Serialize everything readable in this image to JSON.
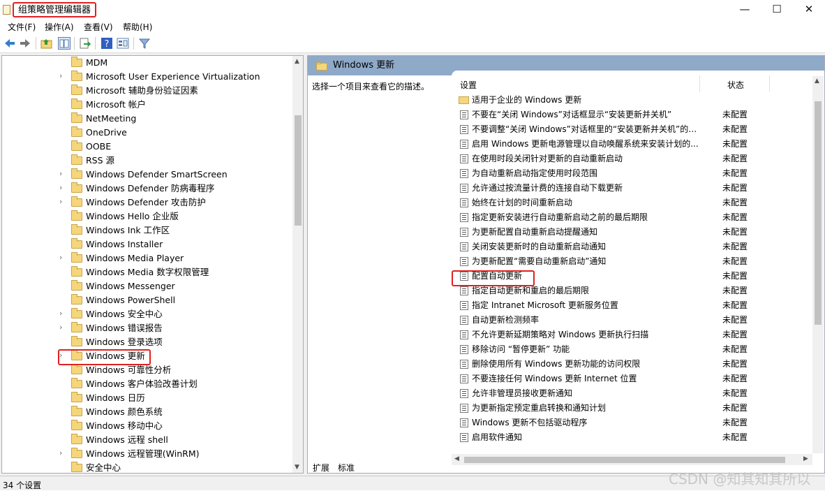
{
  "window": {
    "title": "组策略管理编辑器",
    "min": "—",
    "max": "☐",
    "close": "✕"
  },
  "menu": [
    "文件(F)",
    "操作(A)",
    "查看(V)",
    "帮助(H)"
  ],
  "tree": [
    {
      "label": "MDM",
      "chevron": false
    },
    {
      "label": "Microsoft User Experience Virtualization",
      "chevron": true
    },
    {
      "label": "Microsoft 辅助身份验证因素",
      "chevron": false
    },
    {
      "label": "Microsoft 帐户",
      "chevron": false
    },
    {
      "label": "NetMeeting",
      "chevron": false
    },
    {
      "label": "OneDrive",
      "chevron": false
    },
    {
      "label": "OOBE",
      "chevron": false
    },
    {
      "label": "RSS 源",
      "chevron": false
    },
    {
      "label": "Windows Defender SmartScreen",
      "chevron": true
    },
    {
      "label": "Windows Defender 防病毒程序",
      "chevron": true
    },
    {
      "label": "Windows Defender 攻击防护",
      "chevron": true
    },
    {
      "label": "Windows Hello 企业版",
      "chevron": false
    },
    {
      "label": "Windows Ink 工作区",
      "chevron": false
    },
    {
      "label": "Windows Installer",
      "chevron": false
    },
    {
      "label": "Windows Media Player",
      "chevron": true
    },
    {
      "label": "Windows Media 数字权限管理",
      "chevron": false
    },
    {
      "label": "Windows Messenger",
      "chevron": false
    },
    {
      "label": "Windows PowerShell",
      "chevron": false
    },
    {
      "label": "Windows 安全中心",
      "chevron": true
    },
    {
      "label": "Windows 错误报告",
      "chevron": true
    },
    {
      "label": "Windows 登录选项",
      "chevron": false
    },
    {
      "label": "Windows 更新",
      "chevron": true
    },
    {
      "label": "Windows 可靠性分析",
      "chevron": false
    },
    {
      "label": "Windows 客户体验改善计划",
      "chevron": false
    },
    {
      "label": "Windows 日历",
      "chevron": false
    },
    {
      "label": "Windows 颜色系统",
      "chevron": false
    },
    {
      "label": "Windows 移动中心",
      "chevron": false
    },
    {
      "label": "Windows 远程 shell",
      "chevron": false
    },
    {
      "label": "Windows 远程管理(WinRM)",
      "chevron": true
    },
    {
      "label": "安全中心",
      "chevron": false
    }
  ],
  "right": {
    "header": "Windows 更新",
    "description": "选择一个项目来查看它的描述。",
    "col_setting": "设置",
    "col_state": "状态",
    "rows": [
      {
        "text": "适用于企业的 Windows 更新",
        "state": "",
        "folder": true
      },
      {
        "text": "不要在“关闭 Windows”对话框显示“安装更新并关机”",
        "state": "未配置",
        "folder": false
      },
      {
        "text": "不要调整“关闭 Windows”对话框里的“安装更新并关机”的默...",
        "state": "未配置",
        "folder": false
      },
      {
        "text": "启用 Windows 更新电源管理以自动唤醒系统来安装计划的...",
        "state": "未配置",
        "folder": false
      },
      {
        "text": "在使用时段关闭针对更新的自动重新启动",
        "state": "未配置",
        "folder": false
      },
      {
        "text": "为自动重新启动指定使用时段范围",
        "state": "未配置",
        "folder": false
      },
      {
        "text": "允许通过按流量计费的连接自动下载更新",
        "state": "未配置",
        "folder": false
      },
      {
        "text": "始终在计划的时间重新启动",
        "state": "未配置",
        "folder": false
      },
      {
        "text": "指定更新安装进行自动重新启动之前的最后期限",
        "state": "未配置",
        "folder": false
      },
      {
        "text": "为更新配置自动重新启动提醒通知",
        "state": "未配置",
        "folder": false
      },
      {
        "text": "关闭安装更新时的自动重新启动通知",
        "state": "未配置",
        "folder": false
      },
      {
        "text": "为更新配置“需要自动重新启动”通知",
        "state": "未配置",
        "folder": false
      },
      {
        "text": "配置自动更新",
        "state": "未配置",
        "folder": false
      },
      {
        "text": "指定自动更新和重启的最后期限",
        "state": "未配置",
        "folder": false
      },
      {
        "text": "指定 Intranet Microsoft 更新服务位置",
        "state": "未配置",
        "folder": false
      },
      {
        "text": "自动更新检测频率",
        "state": "未配置",
        "folder": false
      },
      {
        "text": "不允许更新延期策略对 Windows 更新执行扫描",
        "state": "未配置",
        "folder": false
      },
      {
        "text": "移除访问 “暂停更新” 功能",
        "state": "未配置",
        "folder": false
      },
      {
        "text": "删除使用所有 Windows 更新功能的访问权限",
        "state": "未配置",
        "folder": false
      },
      {
        "text": "不要连接任何 Windows 更新 Internet 位置",
        "state": "未配置",
        "folder": false
      },
      {
        "text": "允许非管理员接收更新通知",
        "state": "未配置",
        "folder": false
      },
      {
        "text": "为更新指定预定重启转换和通知计划",
        "state": "未配置",
        "folder": false
      },
      {
        "text": "Windows 更新不包括驱动程序",
        "state": "未配置",
        "folder": false
      },
      {
        "text": "启用软件通知",
        "state": "未配置",
        "folder": false
      }
    ]
  },
  "tabs": [
    "扩展",
    "标准"
  ],
  "status": "34 个设置",
  "watermark": "CSDN @知其知其所以"
}
